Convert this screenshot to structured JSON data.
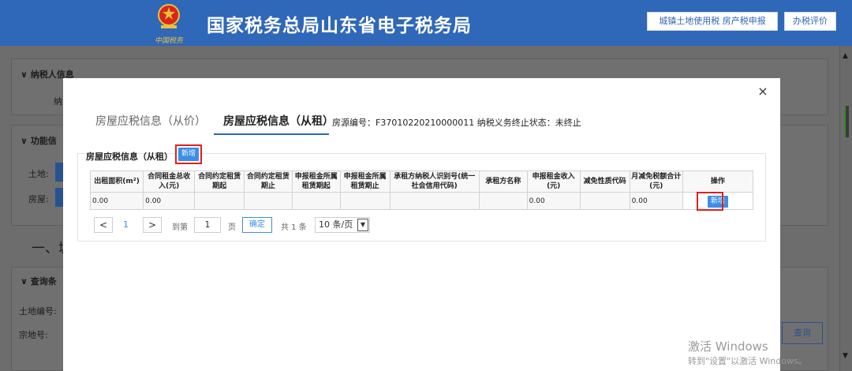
{
  "header": {
    "title": "国家税务总局山东省电子税务局",
    "emblem_caption": "中国税务",
    "buttons": [
      "城镇土地使用税 房产税申报",
      "办税评价"
    ]
  },
  "background": {
    "sections": {
      "taxpayer_info": "纳税人信息",
      "taxpayer_row_label": "纳",
      "function": "功能信",
      "land": "土地:",
      "house": "房屋:",
      "section_one": "一、城",
      "query": "查询条",
      "land_no": "土地编号:",
      "parcel_no": "宗地号:",
      "query_button": "查询"
    }
  },
  "modal": {
    "close": "×",
    "tabs": [
      {
        "label": "房屋应税信息（从价）",
        "active": false
      },
      {
        "label": "房屋应税信息（从租）",
        "active": true
      }
    ],
    "info": "房源编号：F37010220210000011 纳税义务终止状态：未终止",
    "box_title": "房屋应税信息（从租）",
    "add_label": "新增",
    "table": {
      "headers": [
        "出租面积(m²)",
        "合同租金总收入(元)",
        "合同约定租赁期起",
        "合同约定租赁期止",
        "申报租金所属租赁期起",
        "申报租金所属租赁期止",
        "承租方纳税人识别号(统一社会信用代码)",
        "承租方名称",
        "申报租金收入(元)",
        "减免性质代码",
        "月减免税额合计(元)",
        "操作"
      ],
      "rows": [
        [
          "0.00",
          "0.00",
          "",
          "",
          "",
          "",
          "",
          "",
          "0.00",
          "",
          "0.00",
          "新增"
        ]
      ]
    },
    "pager": {
      "prev": "<",
      "current_page": "1",
      "next": ">",
      "goto_label": "到第",
      "page_input": "1",
      "page_unit": "页",
      "confirm": "确定",
      "total": "共 1 条",
      "page_size": "10 条/页"
    }
  },
  "watermark": {
    "line1": "激活 Windows",
    "line2": "转到\"设置\"以激活 Windows。"
  },
  "colors": {
    "brand_blue": "#2f67b9",
    "button_blue": "#3c8ee6",
    "highlight_red": "#e0201c"
  }
}
